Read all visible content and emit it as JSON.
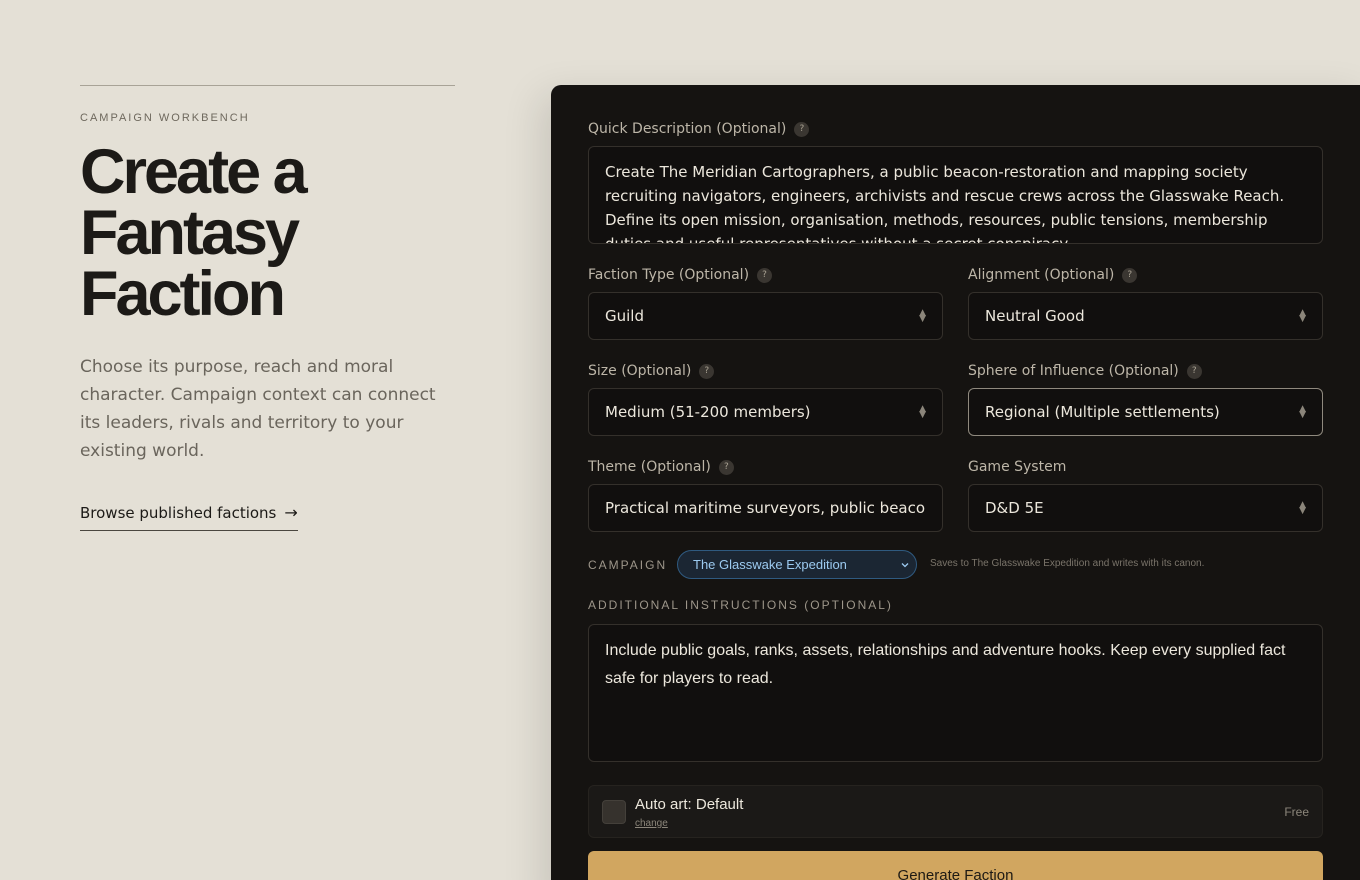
{
  "hero": {
    "eyebrow": "CAMPAIGN WORKBENCH",
    "title_lines": [
      "Create a",
      "Fantasy",
      "Faction"
    ],
    "lede": "Choose its purpose, reach and moral character. Campaign context can connect its leaders, rivals and territory to your existing world.",
    "browse_link": "Browse published factions",
    "browse_arrow": "→"
  },
  "form": {
    "help_glyph": "?",
    "description": {
      "label": "Quick Description (Optional)",
      "value": "Create The Meridian Cartographers, a public beacon-restoration and mapping society recruiting navigators, engineers, archivists and rescue crews across the Glasswake Reach. Define its open mission, organisation, methods, resources, public tensions, membership duties and useful representatives without a secret conspiracy."
    },
    "faction_type": {
      "label": "Faction Type (Optional)",
      "value": "Guild"
    },
    "alignment": {
      "label": "Alignment (Optional)",
      "value": "Neutral Good"
    },
    "size": {
      "label": "Size (Optional)",
      "value": "Medium (51-200 members)"
    },
    "sphere": {
      "label": "Sphere of Influence (Optional)",
      "value": "Regional (Multiple settlements)"
    },
    "theme": {
      "label": "Theme (Optional)",
      "value": "Practical maritime surveyors, public beacons"
    },
    "game_system": {
      "label": "Game System",
      "value": "D&D 5E"
    },
    "campaign": {
      "label": "CAMPAIGN",
      "value": "The Glasswake Expedition",
      "note": "Saves to The Glasswake Expedition and writes with its canon."
    },
    "additional": {
      "label": "ADDITIONAL INSTRUCTIONS (OPTIONAL)",
      "value": "Include public goals, ranks, assets, relationships and adventure hooks. Keep every supplied fact safe for players to read."
    },
    "auto_art": {
      "label": "Auto art: Default",
      "change": "change",
      "price": "Free",
      "checked": false
    },
    "submit": "Generate Faction"
  },
  "colors": {
    "accent": "#d1a660",
    "panel": "#151311",
    "page": "#e4e0d6",
    "campaign": "#9ccaf0"
  }
}
